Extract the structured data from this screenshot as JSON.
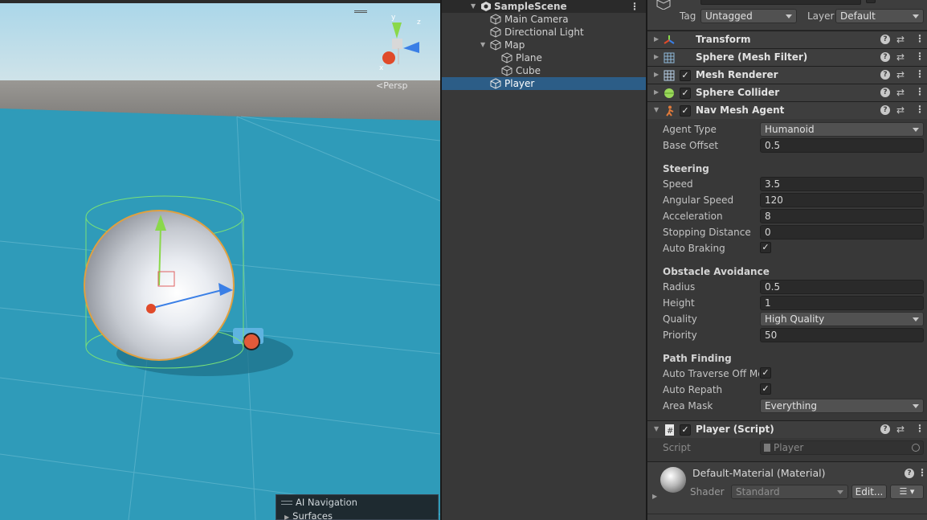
{
  "scene_view": {
    "camera_label": "Persp",
    "gizmo_axes": {
      "y": "y",
      "x": "x",
      "z": "z"
    },
    "overlay": {
      "title": "AI Navigation",
      "item": "Surfaces"
    }
  },
  "hierarchy": {
    "scene_name": "SampleScene",
    "menu_icon": "⋮",
    "items": [
      {
        "label": "Main Camera"
      },
      {
        "label": "Directional Light"
      },
      {
        "label": "Map"
      },
      {
        "label": "Plane"
      },
      {
        "label": "Cube"
      },
      {
        "label": "Player"
      }
    ]
  },
  "inspector": {
    "tag_label": "Tag",
    "tag_value": "Untagged",
    "layer_label": "Layer",
    "layer_value": "Default",
    "components": [
      {
        "name": "Transform",
        "icon": "transform-icon"
      },
      {
        "name": "Sphere (Mesh Filter)",
        "icon": "mesh-filter-icon"
      },
      {
        "name": "Mesh Renderer",
        "icon": "mesh-renderer-icon",
        "enabled": "✓"
      },
      {
        "name": "Sphere Collider",
        "icon": "sphere-collider-icon",
        "enabled": "✓"
      },
      {
        "name": "Nav Mesh Agent",
        "icon": "nav-mesh-agent-icon",
        "enabled": "✓"
      },
      {
        "name": "Player (Script)",
        "icon": "script-icon",
        "enabled": "✓"
      }
    ],
    "help_glyph": "?",
    "settings_glyph": "⇄",
    "more_glyph": "⋮",
    "nav_mesh_agent": {
      "agent_type": {
        "label": "Agent Type",
        "value": "Humanoid"
      },
      "base_offset": {
        "label": "Base Offset",
        "value": "0.5"
      },
      "steering_header": "Steering",
      "speed": {
        "label": "Speed",
        "value": "3.5"
      },
      "angular_speed": {
        "label": "Angular Speed",
        "value": "120"
      },
      "acceleration": {
        "label": "Acceleration",
        "value": "8"
      },
      "stopping_distance": {
        "label": "Stopping Distance",
        "value": "0"
      },
      "auto_braking": {
        "label": "Auto Braking",
        "value": "✓"
      },
      "obstacle_header": "Obstacle Avoidance",
      "radius": {
        "label": "Radius",
        "value": "0.5"
      },
      "height": {
        "label": "Height",
        "value": "1"
      },
      "quality": {
        "label": "Quality",
        "value": "High Quality"
      },
      "priority": {
        "label": "Priority",
        "value": "50"
      },
      "path_header": "Path Finding",
      "auto_traverse": {
        "label": "Auto Traverse Off Me",
        "value": "✓"
      },
      "auto_repath": {
        "label": "Auto Repath",
        "value": "✓"
      },
      "area_mask": {
        "label": "Area Mask",
        "value": "Everything"
      }
    },
    "player_script": {
      "script_label": "Script",
      "script_value": "Player"
    },
    "material": {
      "name": "Default-Material (Material)",
      "shader_label": "Shader",
      "shader_value": "Standard",
      "edit_label": "Edit...",
      "list_glyph": "☰ ▾"
    }
  }
}
